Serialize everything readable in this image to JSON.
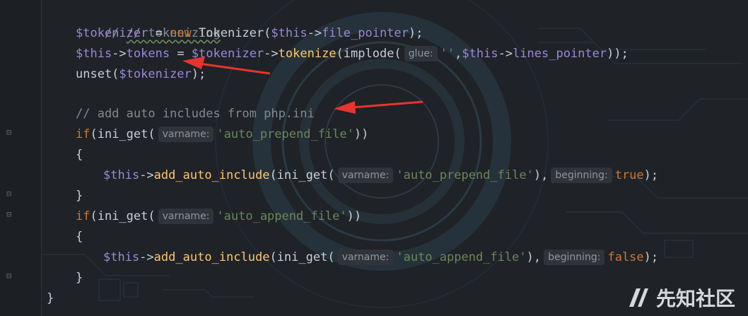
{
  "code": {
    "comment_tokenizing": "// tokenizing",
    "line_tokenizer_var": "$tokenizer",
    "op_assign": " = ",
    "kw_new": "new",
    "class_tokenizer": " Tokenizer(",
    "this_var": "$this",
    "arrow_op": "->",
    "prop_file_pointer": "file_pointer",
    "close_semicolon": ");",
    "prop_tokens": "tokens",
    "tokenizer_ref": "$tokenizer",
    "method_tokenize": "tokenize",
    "implode_open": "(implode(",
    "hint_glue": "glue:",
    "empty_string": "''",
    "comma": ",",
    "prop_lines_pointer": "lines_pointer",
    "close_double": "));",
    "unset_open": "unset(",
    "comment_includes": "// add auto includes from php.ini",
    "kw_if": "if",
    "ini_get_open": "(ini_get(",
    "hint_varname": "varname:",
    "str_prepend": "'auto_prepend_file'",
    "close_if": "))",
    "brace_open": "{",
    "brace_close": "}",
    "method_add_auto_include": "add_auto_include",
    "paren_ini_get": "(ini_get(",
    "close_paren_comma": "),",
    "hint_beginning": "beginning:",
    "kw_true": "true",
    "str_append": "'auto_append_file'",
    "kw_false": "false",
    "close_stmt": ");"
  },
  "watermark": {
    "logo_icon": "xianzhi-logo-icon",
    "text": "先知社区"
  },
  "colors": {
    "keyword": "#cc7832",
    "variable": "#9a88d8",
    "function": "#ffc66d",
    "string": "#6a8759",
    "comment": "#808a94",
    "arrow": "#e8342c"
  }
}
